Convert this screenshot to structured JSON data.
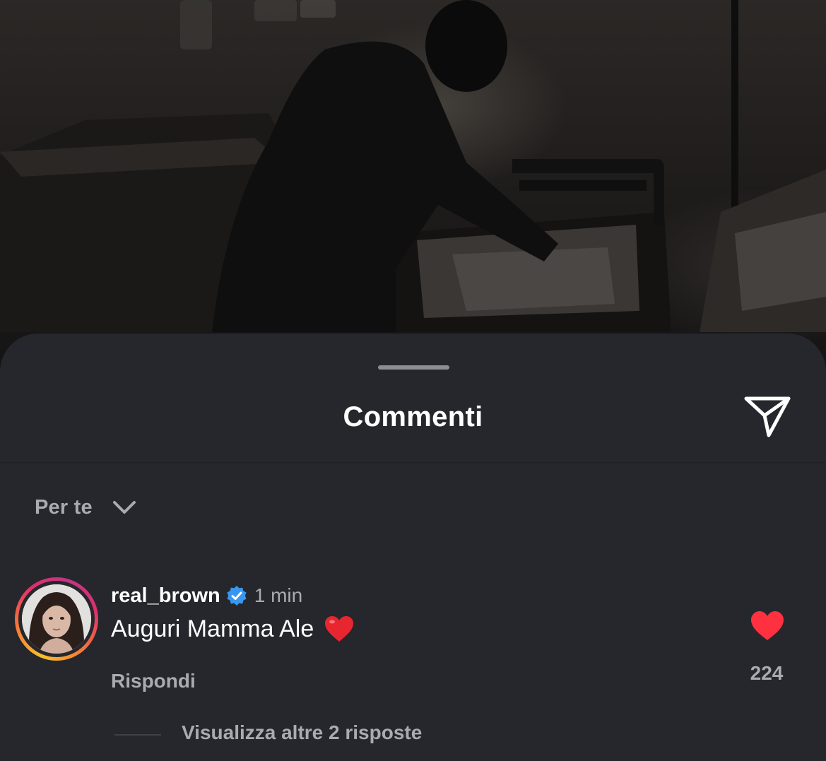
{
  "background_photo": {
    "description_icon": "photo"
  },
  "sheet": {
    "title": "Commenti",
    "share_icon": "paper-plane-icon",
    "sort": {
      "label": "Per te",
      "icon": "chevron-down-icon"
    }
  },
  "comments": [
    {
      "username": "real_brown",
      "verified": true,
      "time": "1 min",
      "text": "Auguri Mamma Ale",
      "emoji": "heart-emoji",
      "reply_label": "Rispondi",
      "liked": true,
      "like_count": "224",
      "more_replies_label": "Visualizza altre 2 risposte"
    }
  ],
  "colors": {
    "sheet_bg": "#25272c",
    "text_primary": "#ffffff",
    "text_secondary": "#a9abb0",
    "verified_blue": "#3897f0",
    "like_red": "#ff3040"
  }
}
